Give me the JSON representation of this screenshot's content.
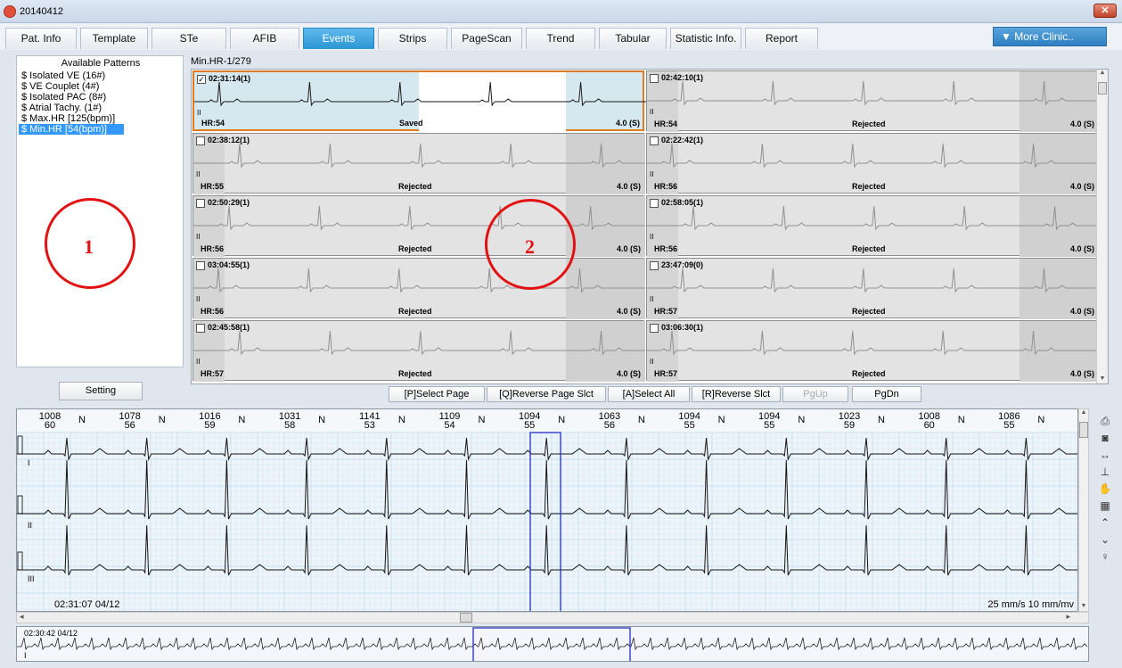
{
  "window": {
    "title": "20140412",
    "close_label": "✕"
  },
  "tabs": [
    {
      "label": "Pat. Info",
      "active": false
    },
    {
      "label": "Template",
      "active": false
    },
    {
      "label": "STe",
      "active": false
    },
    {
      "label": "AFIB",
      "active": false
    },
    {
      "label": "Events",
      "active": true
    },
    {
      "label": "Strips",
      "active": false
    },
    {
      "label": "PageScan",
      "active": false
    },
    {
      "label": "Trend",
      "active": false
    },
    {
      "label": "Tabular",
      "active": false
    },
    {
      "label": "Statistic Info.",
      "active": false
    },
    {
      "label": "Report",
      "active": false
    }
  ],
  "more_button": "▼ More Clinic..",
  "patterns": {
    "title": "Available Patterns",
    "items": [
      {
        "label": "$   Isolated VE (16#)",
        "selected": false
      },
      {
        "label": "$   VE Couplet (4#)",
        "selected": false
      },
      {
        "label": "$   Isolated PAC (8#)",
        "selected": false
      },
      {
        "label": "$   Atrial Tachy. (1#)",
        "selected": false
      },
      {
        "label": "$   Max.HR [125(bpm)]",
        "selected": false
      },
      {
        "label": "$   Min.HR [54(bpm)]",
        "selected": true
      }
    ]
  },
  "setting_label": "Setting",
  "grid_label": "Min.HR-1/279",
  "strips": [
    {
      "time": "02:31:14(1)",
      "hr": "HR:54",
      "status": "Saved",
      "dur": "4.0 (S)",
      "checked": true,
      "lead": "II"
    },
    {
      "time": "02:42:10(1)",
      "hr": "HR:54",
      "status": "Rejected",
      "dur": "4.0 (S)",
      "checked": false,
      "lead": "II"
    },
    {
      "time": "02:38:12(1)",
      "hr": "HR:55",
      "status": "Rejected",
      "dur": "4.0 (S)",
      "checked": false,
      "lead": "II"
    },
    {
      "time": "02:22:42(1)",
      "hr": "HR:56",
      "status": "Rejected",
      "dur": "4.0 (S)",
      "checked": false,
      "lead": "II"
    },
    {
      "time": "02:50:29(1)",
      "hr": "HR:56",
      "status": "Rejected",
      "dur": "4.0 (S)",
      "checked": false,
      "lead": "II"
    },
    {
      "time": "02:58:05(1)",
      "hr": "HR:56",
      "status": "Rejected",
      "dur": "4.0 (S)",
      "checked": false,
      "lead": "II"
    },
    {
      "time": "03:04:55(1)",
      "hr": "HR:56",
      "status": "Rejected",
      "dur": "4.0 (S)",
      "checked": false,
      "lead": "II"
    },
    {
      "time": "23:47:09(0)",
      "hr": "HR:57",
      "status": "Rejected",
      "dur": "4.0 (S)",
      "checked": false,
      "lead": "II"
    },
    {
      "time": "02:45:58(1)",
      "hr": "HR:57",
      "status": "Rejected",
      "dur": "4.0 (S)",
      "checked": false,
      "lead": "II"
    },
    {
      "time": "03:06:30(1)",
      "hr": "HR:57",
      "status": "Rejected",
      "dur": "4.0 (S)",
      "checked": false,
      "lead": "II"
    }
  ],
  "grid_buttons": [
    {
      "label": "[P]Select Page",
      "disabled": false
    },
    {
      "label": "[Q]Reverse Page Slct",
      "disabled": false
    },
    {
      "label": "[A]Select All",
      "disabled": false
    },
    {
      "label": "[R]Reverse Slct",
      "disabled": false
    },
    {
      "label": "PgUp",
      "disabled": true
    },
    {
      "label": "PgDn",
      "disabled": false
    }
  ],
  "beats": [
    {
      "rr": "1008",
      "hr": "60",
      "type": "N"
    },
    {
      "rr": "1078",
      "hr": "56",
      "type": "N"
    },
    {
      "rr": "1016",
      "hr": "59",
      "type": "N"
    },
    {
      "rr": "1031",
      "hr": "58",
      "type": "N"
    },
    {
      "rr": "1141",
      "hr": "53",
      "type": "N"
    },
    {
      "rr": "1109",
      "hr": "54",
      "type": "N"
    },
    {
      "rr": "1094",
      "hr": "55",
      "type": "N"
    },
    {
      "rr": "1063",
      "hr": "56",
      "type": "N"
    },
    {
      "rr": "1094",
      "hr": "55",
      "type": "N"
    },
    {
      "rr": "1094",
      "hr": "55",
      "type": "N"
    },
    {
      "rr": "1023",
      "hr": "59",
      "type": "N"
    },
    {
      "rr": "1008",
      "hr": "60",
      "type": "N"
    },
    {
      "rr": "1086",
      "hr": "55",
      "type": "N"
    }
  ],
  "ecg": {
    "leads": [
      "I",
      "II",
      "III"
    ],
    "timestamp": "02:31:07 04/12",
    "scale": "25 mm/s 10 mm/mv"
  },
  "overview": {
    "timestamp": "02:30:42 04/12",
    "lead": "I"
  },
  "toolbar": [
    "printer-icon",
    "camera-icon",
    "fit-width-icon",
    "measure-icon",
    "hand-icon",
    "settings-icon",
    "gain-up-icon",
    "gain-down-icon",
    "caliper-icon"
  ],
  "annotations": [
    "1",
    "2"
  ],
  "colors": {
    "accent": "#2c95d5",
    "selection": "#3399ff",
    "saved_border": "#e07a24",
    "annotation": "#e21212",
    "ecg_grid": "#c8dfee"
  }
}
